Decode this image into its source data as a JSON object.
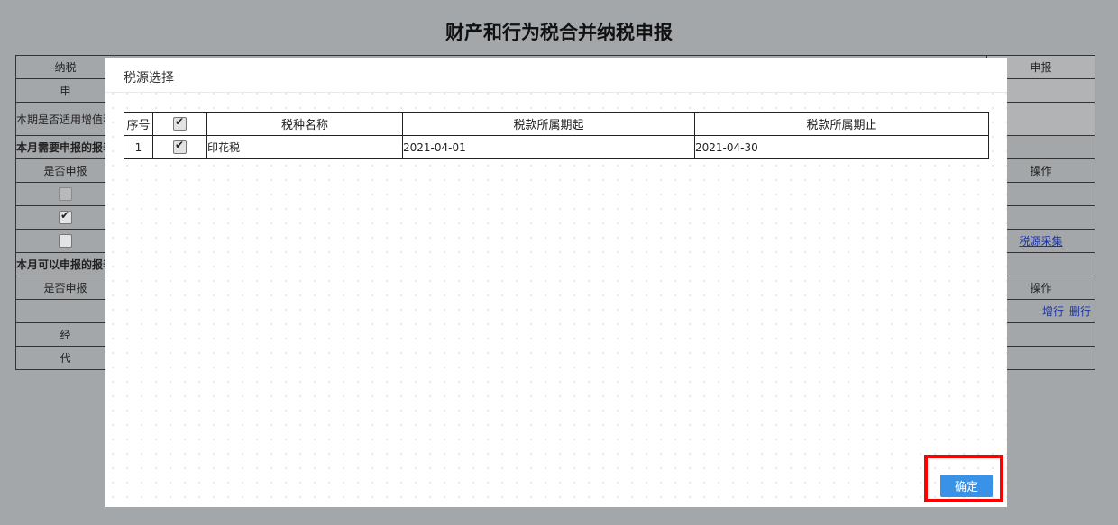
{
  "background": {
    "page_title": "财产和行为税合并纳税申报",
    "rows": {
      "r1_left": "纳税",
      "r1_right": "申报",
      "r2_left": "申",
      "r3_left": "本期是否适用增值税",
      "r4_left": "本月需要申报的报表",
      "r5_left": "是否申报",
      "r5_right": "操作",
      "r8_link": "税源采集",
      "r9_left": "本月可以申报的报表",
      "r10_left": "是否申报",
      "r10_right": "操作",
      "r11_add": "增行",
      "r11_delete": "删行",
      "r12_left": "经",
      "r13_left": "代"
    }
  },
  "dialog": {
    "title": "税源选择",
    "table": {
      "headers": [
        "序号",
        "",
        "税种名称",
        "税款所属期起",
        "税款所属期止"
      ],
      "rows": [
        {
          "index": "1",
          "checked": true,
          "tax_name": "印花税",
          "period_start": "2021-04-01",
          "period_end": "2021-04-30"
        }
      ]
    },
    "confirm_label": "确定"
  },
  "colors": {
    "accent": "#3a92e6",
    "highlight": "#ff0000",
    "overlay": "#a4a7aa"
  }
}
